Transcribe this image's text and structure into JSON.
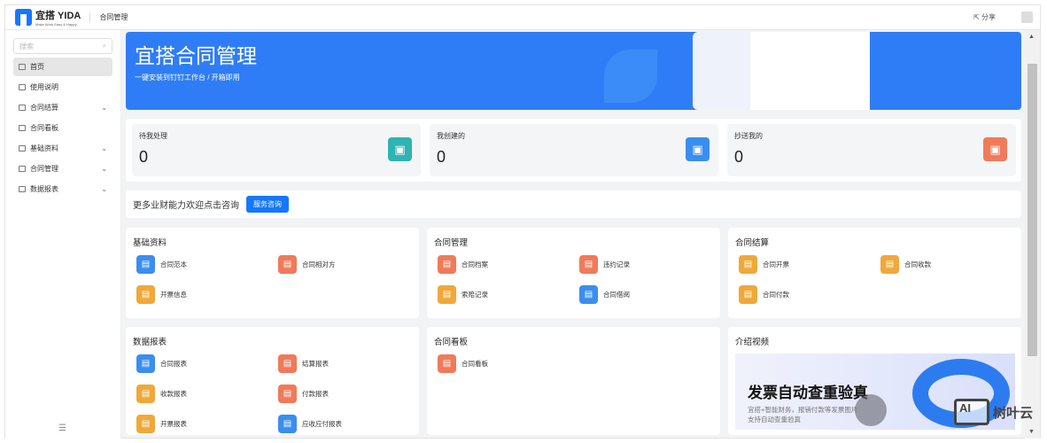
{
  "header": {
    "logo_text": "宜搭 YIDA",
    "logo_sub": "Make Work Easy & Happy",
    "app_title": "合同管理",
    "share": "分享"
  },
  "sidebar": {
    "search_placeholder": "搜索",
    "items": [
      {
        "label": "首页",
        "active": true
      },
      {
        "label": "使用说明"
      },
      {
        "label": "合同结算",
        "expandable": true
      },
      {
        "label": "合同看板"
      },
      {
        "label": "基础资料",
        "expandable": true
      },
      {
        "label": "合同管理",
        "expandable": true
      },
      {
        "label": "数据报表",
        "expandable": true
      }
    ]
  },
  "banner": {
    "title": "宜搭合同管理",
    "subtitle": "一键安装到钉钉工作台 / 开箱即用"
  },
  "stats": [
    {
      "label": "待我处理",
      "value": "0",
      "color": "#2fb3b3"
    },
    {
      "label": "我创建的",
      "value": "0",
      "color": "#3a8ef0"
    },
    {
      "label": "抄送我的",
      "value": "0",
      "color": "#f07a5a"
    }
  ],
  "consult": {
    "text": "更多业财能力欢迎点击咨询",
    "button": "服务咨询"
  },
  "sections": [
    {
      "title": "基础资料",
      "items": [
        {
          "label": "合同范本",
          "color": "#3a8ef0"
        },
        {
          "label": "合同相对方",
          "color": "#f07a5a"
        },
        {
          "label": "开票信息",
          "color": "#f0a83a"
        }
      ]
    },
    {
      "title": "合同管理",
      "items": [
        {
          "label": "合同档案",
          "color": "#f07a5a"
        },
        {
          "label": "违约记录",
          "color": "#f07a5a"
        },
        {
          "label": "索赔记录",
          "color": "#f0a83a"
        },
        {
          "label": "合同借阅",
          "color": "#3a8ef0"
        }
      ]
    },
    {
      "title": "合同结算",
      "items": [
        {
          "label": "合同开票",
          "color": "#f0a83a"
        },
        {
          "label": "合同收款",
          "color": "#f0a83a"
        },
        {
          "label": "合同付款",
          "color": "#f0a83a"
        }
      ]
    },
    {
      "title": "数据报表",
      "items": [
        {
          "label": "合同报表",
          "color": "#3a8ef0"
        },
        {
          "label": "结算报表",
          "color": "#f07a5a"
        },
        {
          "label": "收款报表",
          "color": "#f0a83a"
        },
        {
          "label": "付款报表",
          "color": "#f07a5a"
        },
        {
          "label": "开票报表",
          "color": "#f0a83a"
        },
        {
          "label": "应收应付报表",
          "color": "#3a8ef0"
        }
      ]
    },
    {
      "title": "合同看板",
      "items": [
        {
          "label": "合同看板",
          "color": "#f07a5a"
        }
      ]
    }
  ],
  "video": {
    "title": "介绍视频",
    "headline": "发票自动查重验真",
    "line1": "宜搭+智能财务，报销付款等发票图片",
    "line2": "支持自动查重验真"
  },
  "watermark": "树叶云"
}
